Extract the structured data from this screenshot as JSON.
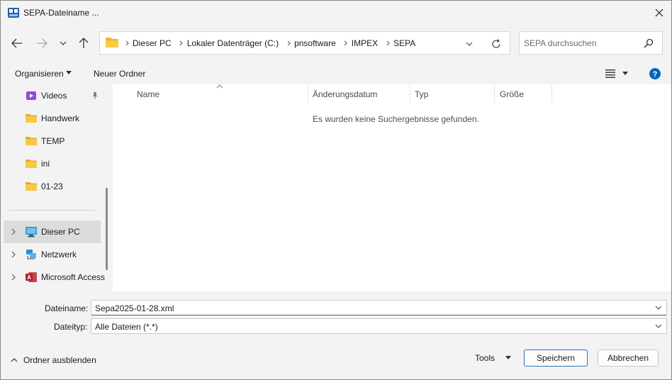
{
  "window": {
    "title": "SEPA-Dateiname ...",
    "accent_color": "#0067c0"
  },
  "address": {
    "crumbs": [
      "Dieser PC",
      "Lokaler Datenträger (C:)",
      "pnsoftware",
      "IMPEX",
      "SEPA"
    ]
  },
  "search": {
    "placeholder": "SEPA durchsuchen"
  },
  "commandbar": {
    "organize_label": "Organisieren",
    "new_folder_label": "Neuer Ordner"
  },
  "navpane": {
    "items": [
      {
        "label": "Videos",
        "icon": "video-folder-icon"
      },
      {
        "label": "Handwerk",
        "icon": "folder-icon"
      },
      {
        "label": "TEMP",
        "icon": "folder-icon"
      },
      {
        "label": "ini",
        "icon": "folder-icon"
      },
      {
        "label": "01-23",
        "icon": "folder-icon"
      },
      {
        "label": "Dieser PC",
        "icon": "computer-icon"
      },
      {
        "label": "Netzwerk",
        "icon": "network-icon"
      },
      {
        "label": "Microsoft Access",
        "icon": "access-icon"
      }
    ]
  },
  "filelist": {
    "columns": [
      "Name",
      "Änderungsdatum",
      "Typ",
      "Größe"
    ],
    "empty_message": "Es wurden keine Suchergebnisse gefunden."
  },
  "form": {
    "filename_label": "Dateiname:",
    "filename_value": "Sepa2025-01-28.xml",
    "filetype_label": "Dateityp:",
    "filetype_value": "Alle Dateien (*.*)"
  },
  "footer": {
    "hide_folders_label": "Ordner ausblenden",
    "tools_label": "Tools",
    "save_label": "Speichern",
    "cancel_label": "Abbrechen"
  }
}
